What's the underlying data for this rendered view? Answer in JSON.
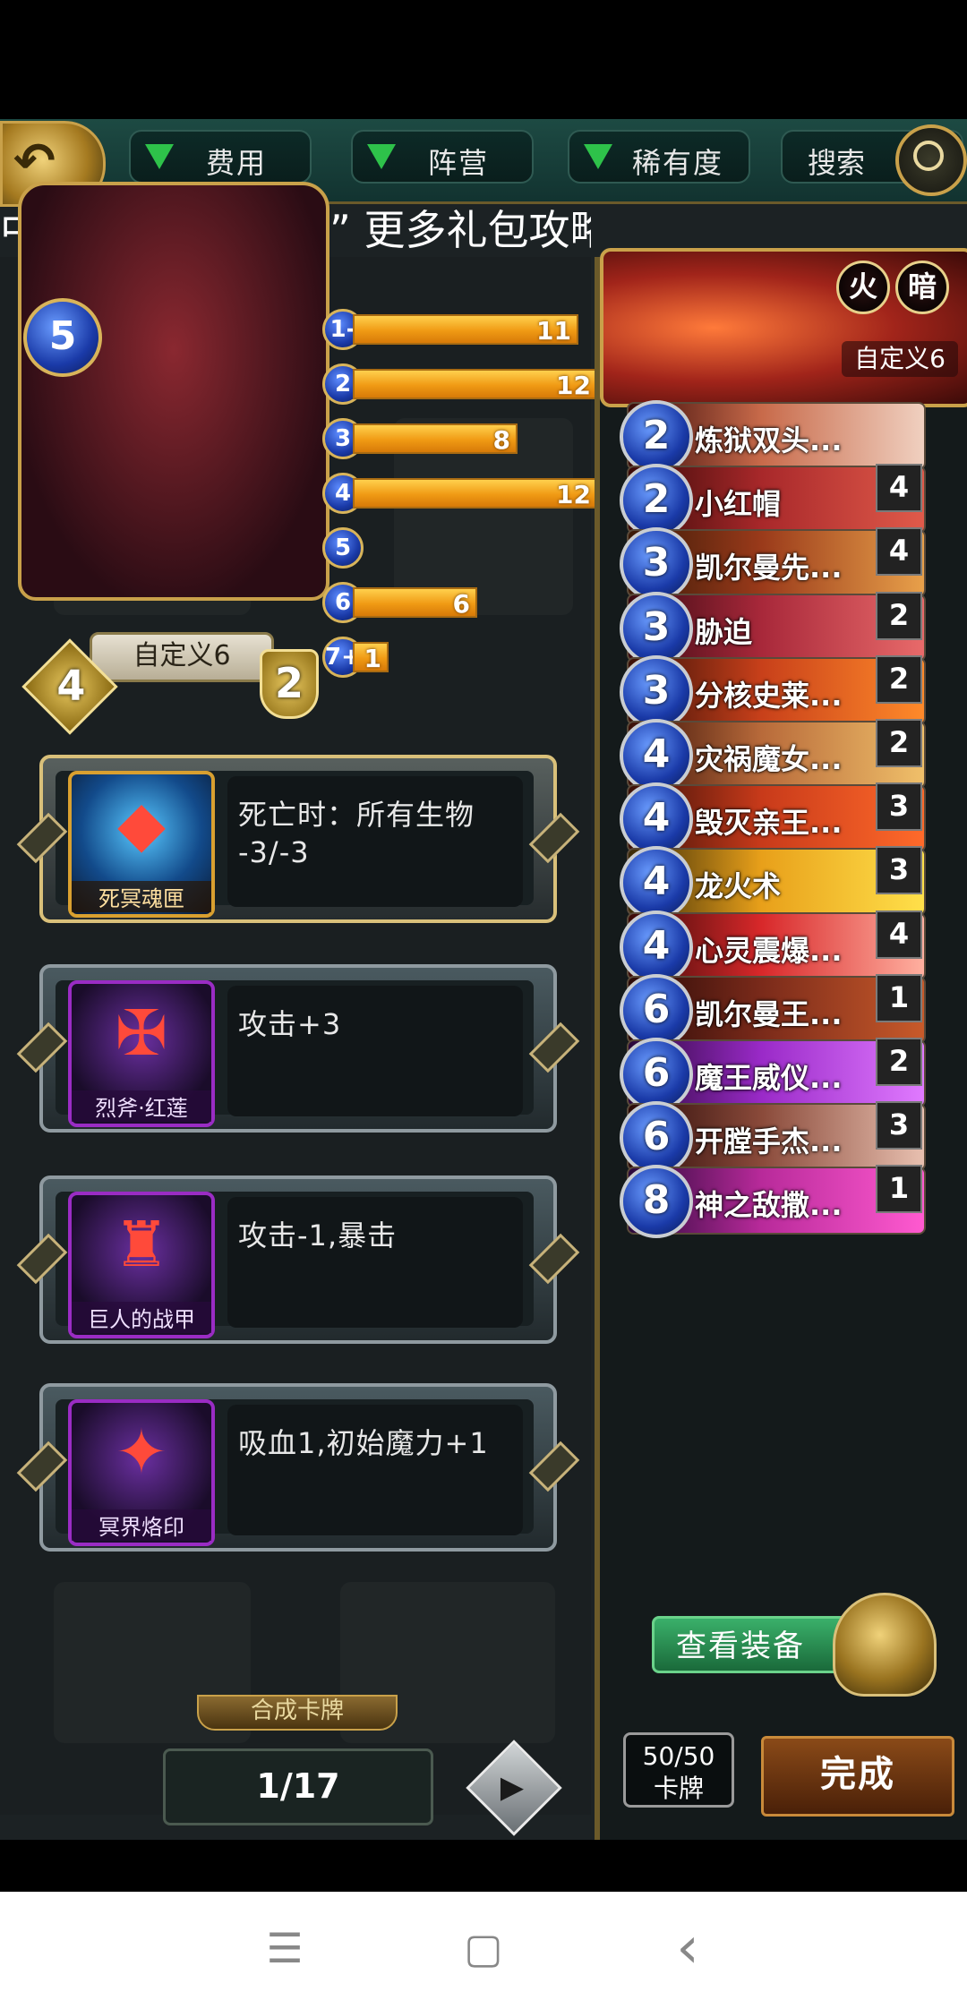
{
  "filters": [
    {
      "label": "费用"
    },
    {
      "label": "阵营"
    },
    {
      "label": "稀有度"
    }
  ],
  "search_label": "搜索",
  "marquee_text": "中国加油武汉加油” 更多礼包攻略请关注公众",
  "hero": {
    "name": "自定义6",
    "mana": "5",
    "attack": "4",
    "health": "2",
    "elements": [
      "火",
      "暗"
    ]
  },
  "cost_curve": [
    {
      "cost": "1-",
      "count": 11,
      "label": "11"
    },
    {
      "cost": "2",
      "count": 12,
      "label": "12"
    },
    {
      "cost": "3",
      "count": 8,
      "label": "8"
    },
    {
      "cost": "4",
      "count": 12,
      "label": "12"
    },
    {
      "cost": "5",
      "count": 0,
      "label": ""
    },
    {
      "cost": "6",
      "count": 6,
      "label": "6"
    },
    {
      "cost": "7+",
      "count": 1,
      "label": "1"
    }
  ],
  "equipment": [
    {
      "name": "死冥魂匣",
      "desc": "死亡时：所有生物 -3/-3",
      "glyph": "◆",
      "rarity": "gold"
    },
    {
      "name": "烈斧·红莲",
      "desc": "攻击+3",
      "glyph": "✠",
      "rarity": "purple"
    },
    {
      "name": "巨人的战甲",
      "desc": "攻击-1,暴击",
      "glyph": "♜",
      "rarity": "purple"
    },
    {
      "name": "冥界烙印",
      "desc": "吸血1,初始魔力+1",
      "glyph": "✦",
      "rarity": "purple"
    }
  ],
  "compose_tab": "合成卡牌",
  "page_indicator": "1/17",
  "deck": [
    {
      "cost": "2",
      "name": "炼狱双头...",
      "count": ""
    },
    {
      "cost": "2",
      "name": "小红帽",
      "count": "4"
    },
    {
      "cost": "3",
      "name": "凯尔曼先...",
      "count": "4"
    },
    {
      "cost": "3",
      "name": "胁迫",
      "count": "2"
    },
    {
      "cost": "3",
      "name": "分核史莱...",
      "count": "2"
    },
    {
      "cost": "4",
      "name": "灾祸魔女...",
      "count": "2"
    },
    {
      "cost": "4",
      "name": "毁灭亲王...",
      "count": "3"
    },
    {
      "cost": "4",
      "name": "龙火术",
      "count": "3"
    },
    {
      "cost": "4",
      "name": "心灵震爆...",
      "count": "4"
    },
    {
      "cost": "6",
      "name": "凯尔曼王...",
      "count": "1"
    },
    {
      "cost": "6",
      "name": "魔王威仪...",
      "count": "2"
    },
    {
      "cost": "6",
      "name": "开膛手杰...",
      "count": "3"
    },
    {
      "cost": "8",
      "name": "神之敌撒...",
      "count": "1"
    }
  ],
  "view_equip_label": "查看装备",
  "card_count": {
    "value": "50/50",
    "label": "卡牌"
  },
  "done_label": "完成",
  "system_nav": {
    "menu": "☰",
    "home": "▢",
    "back": "‹"
  }
}
